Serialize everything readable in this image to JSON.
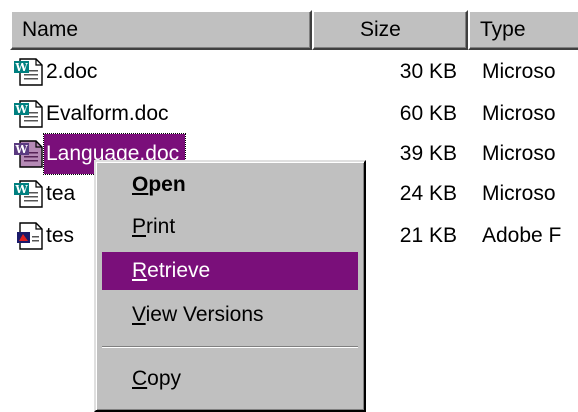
{
  "columns": {
    "name": "Name",
    "size": "Size",
    "type": "Type"
  },
  "files": [
    {
      "name": "2.doc",
      "size": "30 KB",
      "type": "Microso",
      "icon": "word-doc-icon",
      "selected": false
    },
    {
      "name": "Evalform.doc",
      "size": "60 KB",
      "type": "Microso",
      "icon": "word-doc-icon",
      "selected": false
    },
    {
      "name": "Language.doc",
      "size": "39 KB",
      "type": "Microso",
      "icon": "word-doc-icon",
      "selected": true
    },
    {
      "name": "tea",
      "size": "24 KB",
      "type": "Microso",
      "icon": "word-doc-icon",
      "selected": false
    },
    {
      "name": "tes",
      "size": "21 KB",
      "type": "Adobe F",
      "icon": "acrobat-doc-icon",
      "selected": false
    }
  ],
  "context_menu": {
    "items": [
      {
        "pre": "",
        "key": "O",
        "post": "pen",
        "bold": true,
        "highlighted": false
      },
      {
        "pre": "",
        "key": "P",
        "post": "rint",
        "bold": false,
        "highlighted": false
      },
      {
        "pre": "",
        "key": "R",
        "post": "etrieve",
        "bold": false,
        "highlighted": true
      },
      {
        "pre": "",
        "key": "V",
        "post": "iew Versions",
        "bold": false,
        "highlighted": false
      },
      {
        "pre": "",
        "key": "C",
        "post": "opy",
        "bold": false,
        "highlighted": false
      }
    ]
  },
  "colors": {
    "selection": "#7a0f7a",
    "window_bg": "#ffffff",
    "face": "#c0c0c0"
  }
}
